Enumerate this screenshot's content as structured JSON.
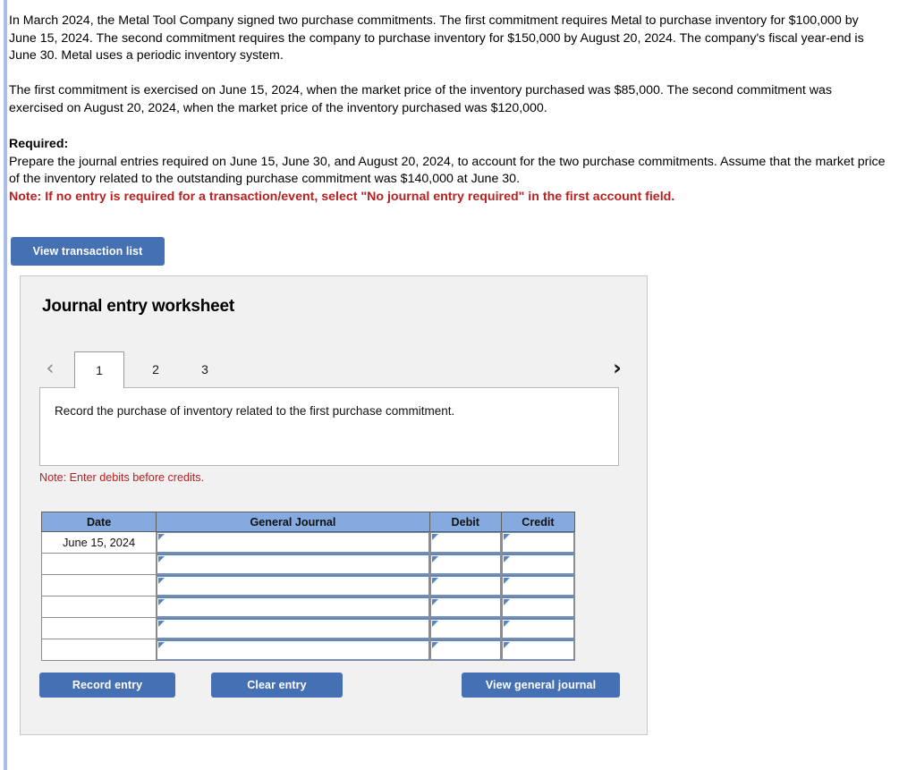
{
  "problem": {
    "paragraph_1": "In March 2024, the Metal Tool Company signed two purchase commitments. The first commitment requires Metal to purchase inventory for $100,000 by June 15, 2024. The second commitment requires the company to purchase inventory for $150,000 by August 20, 2024. The company's fiscal year-end is June 30. Metal uses a periodic inventory system.",
    "paragraph_2": "The first commitment is exercised on June 15, 2024, when the market price of the inventory purchased was $85,000. The second commitment was exercised on August 20, 2024, when the market price of the inventory purchased was $120,000.",
    "required_label": "Required:",
    "required_line_1": "Prepare the journal entries required on June 15, June 30, and August 20, 2024, to account for the two purchase commitments.",
    "required_line_2": "Assume that the market price of the inventory related to the outstanding purchase commitment was $140,000 at June 30.",
    "required_note": "Note: If no entry is required for a transaction/event, select \"No journal entry required\" in the first account field."
  },
  "toolbar": {
    "view_transaction_list_label": "View transaction list"
  },
  "worksheet": {
    "title": "Journal entry worksheet",
    "prev_icon": "‹",
    "next_icon": "›",
    "tabs": [
      {
        "label": "1",
        "active": true
      },
      {
        "label": "2",
        "active": false
      },
      {
        "label": "3",
        "active": false
      }
    ],
    "instruction": "Record the purchase of inventory related to the first purchase commitment.",
    "debit_note": "Note: Enter debits before credits.",
    "table": {
      "columns": [
        "Date",
        "General Journal",
        "Debit",
        "Credit"
      ],
      "rows": [
        {
          "date": "June 15, 2024",
          "general_journal": "",
          "debit": "",
          "credit": ""
        },
        {
          "date": "",
          "general_journal": "",
          "debit": "",
          "credit": ""
        },
        {
          "date": "",
          "general_journal": "",
          "debit": "",
          "credit": ""
        },
        {
          "date": "",
          "general_journal": "",
          "debit": "",
          "credit": ""
        },
        {
          "date": "",
          "general_journal": "",
          "debit": "",
          "credit": ""
        },
        {
          "date": "",
          "general_journal": "",
          "debit": "",
          "credit": ""
        }
      ]
    },
    "buttons": {
      "record_entry": "Record entry",
      "clear_entry": "Clear entry",
      "view_general_journal": "View general journal"
    }
  },
  "colors": {
    "button_blue": "#4571b4",
    "table_header_blue": "#85aadf",
    "note_red": "#b62121",
    "panel_gray": "#f1f1f1",
    "left_stripe": "#a9bfe8",
    "input_border_blue": "#6c8fc9"
  }
}
